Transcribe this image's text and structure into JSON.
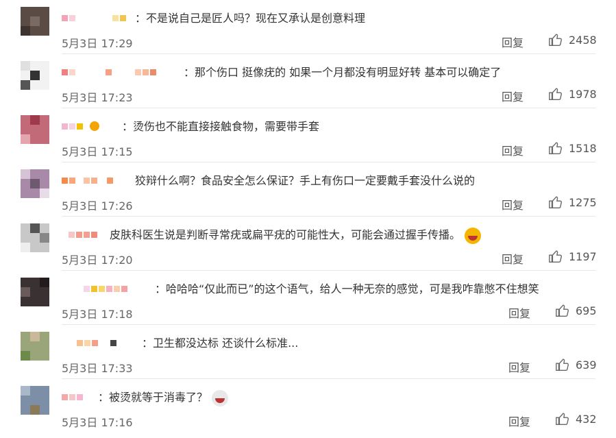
{
  "reply_label": "回复",
  "comments": [
    {
      "text": "：不是说自己是匠人吗？现在又承认是创意料理",
      "time": "5月3日 17:29",
      "likes": "2458"
    },
    {
      "text": "：那个伤口 挺像疣的 如果一个月都没有明显好转 基本可以确定了",
      "time": "5月3日 17:23",
      "likes": "1978"
    },
    {
      "text": "：烫伤也不能直接接触食物，需要带手套",
      "time": "5月3日 17:15",
      "likes": "1518"
    },
    {
      "text": "狡辩什么啊？食品安全怎么保证？手上有伤口一定要戴手套没什么说的",
      "time": "5月3日 17:26",
      "likes": "1275"
    },
    {
      "text": "皮肤科医生说是判断寻常疣或扁平疣的可能性大，可能会通过握手传播。",
      "time": "5月3日 17:20",
      "likes": "1197"
    },
    {
      "text": "：哈哈哈“仅此而已”的这个语气，给人一种无奈的感觉，可是我咋靠憋不住想笑",
      "time": "5月3日 17:18",
      "likes": "695"
    },
    {
      "text": "：卫生都没达标 还谈什么标准...",
      "time": "5月3日 17:33",
      "likes": "639"
    },
    {
      "text": "：被烫就等于消毒了？",
      "time": "5月3日 17:16",
      "likes": "432"
    }
  ]
}
